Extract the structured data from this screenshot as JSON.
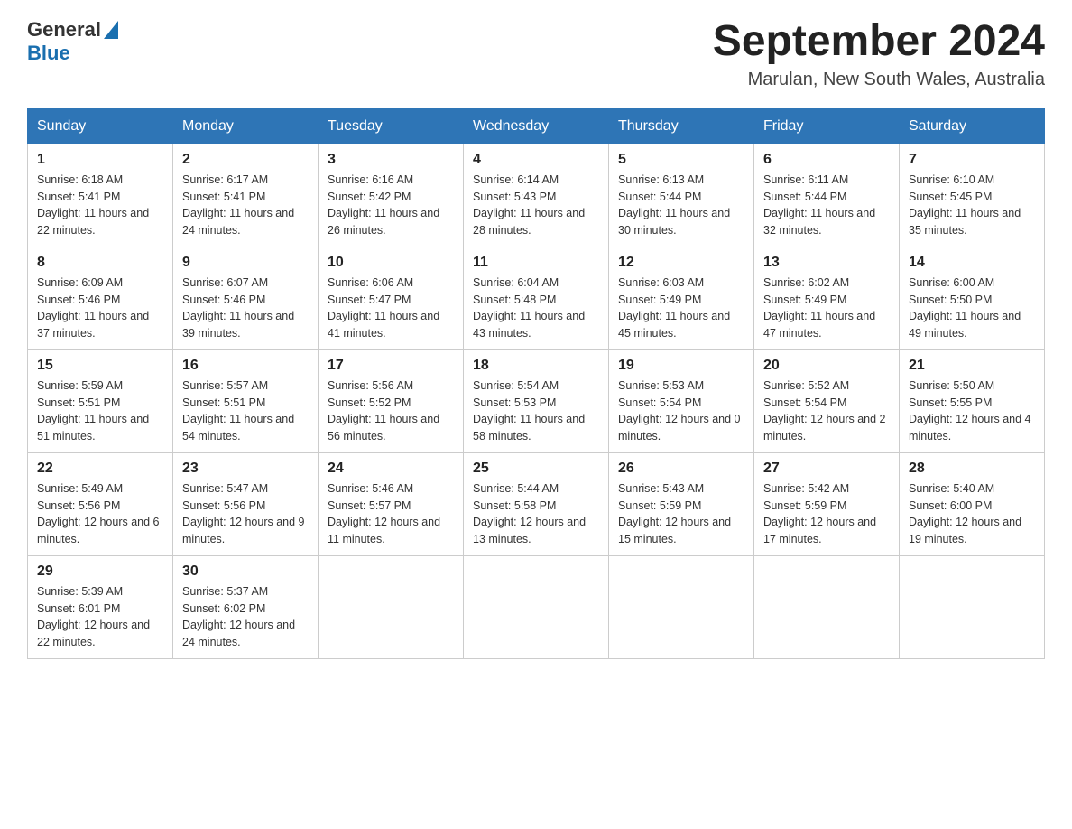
{
  "header": {
    "logo_general": "General",
    "logo_blue": "Blue",
    "title": "September 2024",
    "location": "Marulan, New South Wales, Australia"
  },
  "weekdays": [
    "Sunday",
    "Monday",
    "Tuesday",
    "Wednesday",
    "Thursday",
    "Friday",
    "Saturday"
  ],
  "weeks": [
    [
      {
        "day": "1",
        "sunrise": "6:18 AM",
        "sunset": "5:41 PM",
        "daylight": "11 hours and 22 minutes."
      },
      {
        "day": "2",
        "sunrise": "6:17 AM",
        "sunset": "5:41 PM",
        "daylight": "11 hours and 24 minutes."
      },
      {
        "day": "3",
        "sunrise": "6:16 AM",
        "sunset": "5:42 PM",
        "daylight": "11 hours and 26 minutes."
      },
      {
        "day": "4",
        "sunrise": "6:14 AM",
        "sunset": "5:43 PM",
        "daylight": "11 hours and 28 minutes."
      },
      {
        "day": "5",
        "sunrise": "6:13 AM",
        "sunset": "5:44 PM",
        "daylight": "11 hours and 30 minutes."
      },
      {
        "day": "6",
        "sunrise": "6:11 AM",
        "sunset": "5:44 PM",
        "daylight": "11 hours and 32 minutes."
      },
      {
        "day": "7",
        "sunrise": "6:10 AM",
        "sunset": "5:45 PM",
        "daylight": "11 hours and 35 minutes."
      }
    ],
    [
      {
        "day": "8",
        "sunrise": "6:09 AM",
        "sunset": "5:46 PM",
        "daylight": "11 hours and 37 minutes."
      },
      {
        "day": "9",
        "sunrise": "6:07 AM",
        "sunset": "5:46 PM",
        "daylight": "11 hours and 39 minutes."
      },
      {
        "day": "10",
        "sunrise": "6:06 AM",
        "sunset": "5:47 PM",
        "daylight": "11 hours and 41 minutes."
      },
      {
        "day": "11",
        "sunrise": "6:04 AM",
        "sunset": "5:48 PM",
        "daylight": "11 hours and 43 minutes."
      },
      {
        "day": "12",
        "sunrise": "6:03 AM",
        "sunset": "5:49 PM",
        "daylight": "11 hours and 45 minutes."
      },
      {
        "day": "13",
        "sunrise": "6:02 AM",
        "sunset": "5:49 PM",
        "daylight": "11 hours and 47 minutes."
      },
      {
        "day": "14",
        "sunrise": "6:00 AM",
        "sunset": "5:50 PM",
        "daylight": "11 hours and 49 minutes."
      }
    ],
    [
      {
        "day": "15",
        "sunrise": "5:59 AM",
        "sunset": "5:51 PM",
        "daylight": "11 hours and 51 minutes."
      },
      {
        "day": "16",
        "sunrise": "5:57 AM",
        "sunset": "5:51 PM",
        "daylight": "11 hours and 54 minutes."
      },
      {
        "day": "17",
        "sunrise": "5:56 AM",
        "sunset": "5:52 PM",
        "daylight": "11 hours and 56 minutes."
      },
      {
        "day": "18",
        "sunrise": "5:54 AM",
        "sunset": "5:53 PM",
        "daylight": "11 hours and 58 minutes."
      },
      {
        "day": "19",
        "sunrise": "5:53 AM",
        "sunset": "5:54 PM",
        "daylight": "12 hours and 0 minutes."
      },
      {
        "day": "20",
        "sunrise": "5:52 AM",
        "sunset": "5:54 PM",
        "daylight": "12 hours and 2 minutes."
      },
      {
        "day": "21",
        "sunrise": "5:50 AM",
        "sunset": "5:55 PM",
        "daylight": "12 hours and 4 minutes."
      }
    ],
    [
      {
        "day": "22",
        "sunrise": "5:49 AM",
        "sunset": "5:56 PM",
        "daylight": "12 hours and 6 minutes."
      },
      {
        "day": "23",
        "sunrise": "5:47 AM",
        "sunset": "5:56 PM",
        "daylight": "12 hours and 9 minutes."
      },
      {
        "day": "24",
        "sunrise": "5:46 AM",
        "sunset": "5:57 PM",
        "daylight": "12 hours and 11 minutes."
      },
      {
        "day": "25",
        "sunrise": "5:44 AM",
        "sunset": "5:58 PM",
        "daylight": "12 hours and 13 minutes."
      },
      {
        "day": "26",
        "sunrise": "5:43 AM",
        "sunset": "5:59 PM",
        "daylight": "12 hours and 15 minutes."
      },
      {
        "day": "27",
        "sunrise": "5:42 AM",
        "sunset": "5:59 PM",
        "daylight": "12 hours and 17 minutes."
      },
      {
        "day": "28",
        "sunrise": "5:40 AM",
        "sunset": "6:00 PM",
        "daylight": "12 hours and 19 minutes."
      }
    ],
    [
      {
        "day": "29",
        "sunrise": "5:39 AM",
        "sunset": "6:01 PM",
        "daylight": "12 hours and 22 minutes."
      },
      {
        "day": "30",
        "sunrise": "5:37 AM",
        "sunset": "6:02 PM",
        "daylight": "12 hours and 24 minutes."
      },
      null,
      null,
      null,
      null,
      null
    ]
  ],
  "labels": {
    "sunrise": "Sunrise:",
    "sunset": "Sunset:",
    "daylight": "Daylight:"
  }
}
